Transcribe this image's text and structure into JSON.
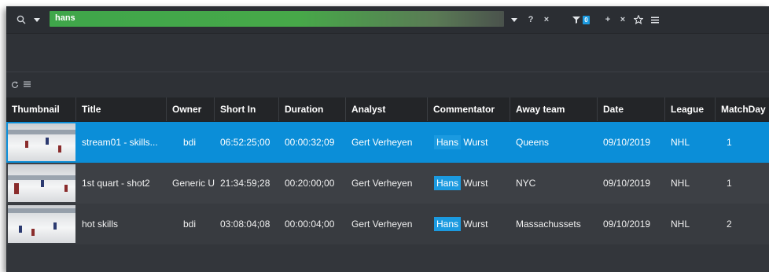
{
  "search": {
    "value": "hans",
    "help_label": "?",
    "clear_label": "×",
    "filter_count": "0",
    "add_label": "+",
    "remove_label": "×"
  },
  "table": {
    "columns": [
      "Thumbnail",
      "Title",
      "Owner",
      "Short In",
      "Duration",
      "Analyst",
      "Commentator",
      "Away team",
      "Date",
      "League",
      "MatchDay"
    ],
    "rows": [
      {
        "title": "stream01 - skills...",
        "owner": "bdi",
        "short_in": "06:52:25;00",
        "duration": "00:00:32;09",
        "analyst": "Gert Verheyen",
        "commentator_first": "Hans",
        "commentator_last": "Wurst",
        "away_team": "Queens",
        "date": "09/10/2019",
        "league": "NHL",
        "matchday": "1"
      },
      {
        "title": "1st quart - shot2",
        "owner": "Generic Us",
        "short_in": "21:34:59;28",
        "duration": "00:20:00;00",
        "analyst": "Gert Verheyen",
        "commentator_first": "Hans",
        "commentator_last": "Wurst",
        "away_team": "NYC",
        "date": "09/10/2019",
        "league": "NHL",
        "matchday": "1"
      },
      {
        "title": "hot skills",
        "owner": "bdi",
        "short_in": "03:08:04;08",
        "duration": "00:00:04;00",
        "analyst": "Gert Verheyen",
        "commentator_first": "Hans",
        "commentator_last": "Wurst",
        "away_team": "Massachussets",
        "date": "09/10/2019",
        "league": "NHL",
        "matchday": "2"
      }
    ],
    "selected_row": 0
  },
  "icons": {
    "search": "search-icon",
    "dropdown": "caret-down-icon",
    "filter": "filter-icon",
    "star": "star-icon",
    "menu": "menu-icon",
    "refresh": "refresh-icon"
  },
  "colors": {
    "selection": "#0b8ed8",
    "highlight": "#1b9ae0",
    "search_field": "#47a849"
  }
}
